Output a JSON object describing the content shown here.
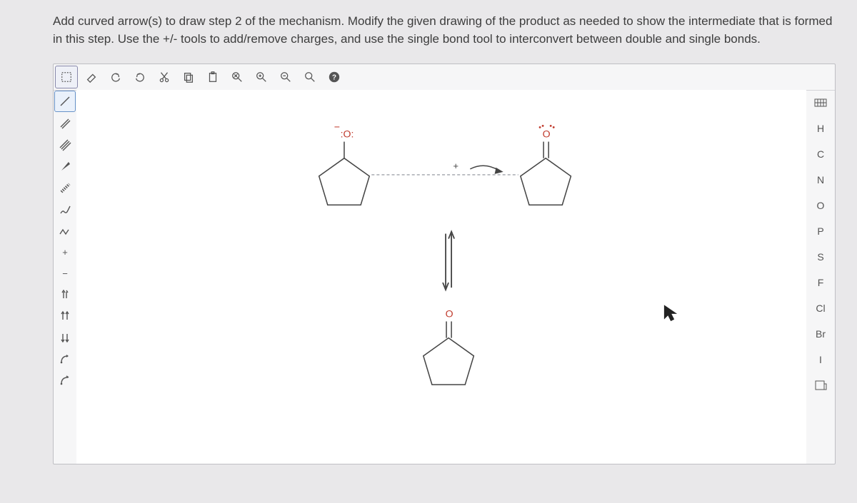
{
  "instructions": "Add curved arrow(s) to draw step 2 of the mechanism. Modify the given drawing of the product as needed to show the intermediate that is formed in this step. Use the +/- tools to add/remove charges, and use the single bond tool to interconvert between double and single bonds.",
  "topbar": [
    {
      "name": "marquee-select-icon",
      "interact": true
    },
    {
      "name": "eraser-icon",
      "interact": true
    },
    {
      "name": "undo-icon",
      "interact": true
    },
    {
      "name": "redo-icon",
      "interact": true
    },
    {
      "name": "cut-icon",
      "interact": true
    },
    {
      "name": "copy-icon",
      "interact": true
    },
    {
      "name": "paste-icon",
      "interact": true
    },
    {
      "name": "zoom-fit-icon",
      "interact": true
    },
    {
      "name": "zoom-in-icon",
      "interact": true
    },
    {
      "name": "zoom-out-icon",
      "interact": true
    },
    {
      "name": "zoom-reset-icon",
      "interact": true
    },
    {
      "name": "help-icon",
      "interact": true
    }
  ],
  "leftbar": [
    {
      "name": "single-bond-icon",
      "interact": true,
      "selected": true
    },
    {
      "name": "double-bond-icon",
      "interact": true
    },
    {
      "name": "triple-bond-icon",
      "interact": true
    },
    {
      "name": "wedge-bond-icon",
      "interact": true
    },
    {
      "name": "hash-bond-icon",
      "interact": true
    },
    {
      "name": "wavy-bond-icon",
      "interact": true
    },
    {
      "name": "chain-icon",
      "interact": true
    },
    {
      "name": "charge-plus-icon",
      "interact": true,
      "label": "+"
    },
    {
      "name": "charge-minus-icon",
      "interact": true,
      "label": "−"
    },
    {
      "name": "electron-pair-up-icon",
      "interact": true
    },
    {
      "name": "electron-pair-both-icon",
      "interact": true
    },
    {
      "name": "electron-pair-down-icon",
      "interact": true
    },
    {
      "name": "curved-arrow-icon",
      "interact": true
    },
    {
      "name": "half-arrow-icon",
      "interact": true
    }
  ],
  "rightbar": [
    {
      "name": "periodic-table-icon",
      "interact": true,
      "label": ""
    },
    {
      "name": "element-h",
      "interact": true,
      "label": "H"
    },
    {
      "name": "element-c",
      "interact": true,
      "label": "C"
    },
    {
      "name": "element-n",
      "interact": true,
      "label": "N"
    },
    {
      "name": "element-o",
      "interact": true,
      "label": "O"
    },
    {
      "name": "element-p",
      "interact": true,
      "label": "P"
    },
    {
      "name": "element-s",
      "interact": true,
      "label": "S"
    },
    {
      "name": "element-f",
      "interact": true,
      "label": "F"
    },
    {
      "name": "element-cl",
      "interact": true,
      "label": "Cl"
    },
    {
      "name": "element-br",
      "interact": true,
      "label": "Br"
    },
    {
      "name": "element-i",
      "interact": true,
      "label": "I"
    },
    {
      "name": "template-icon",
      "interact": true,
      "label": ""
    }
  ],
  "canvas": {
    "left_o_label": ":O:",
    "charge_minus": "−",
    "right_o_label": "O",
    "right_o_dots": "..",
    "bottom_o_label": "O",
    "plus_label": "+"
  }
}
